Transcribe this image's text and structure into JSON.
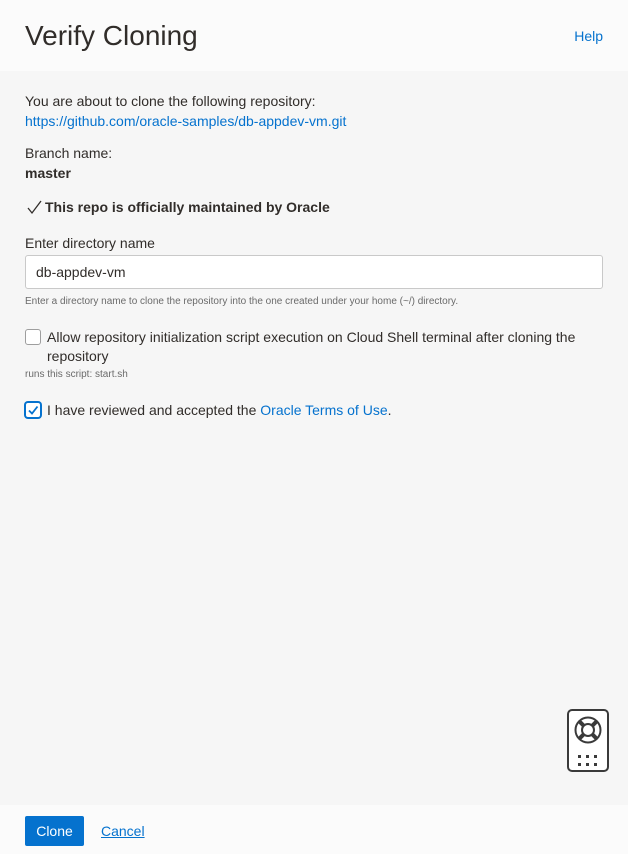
{
  "header": {
    "title": "Verify Cloning",
    "help_label": "Help"
  },
  "repo": {
    "intro": "You are about to clone the following repository:",
    "url": "https://github.com/oracle-samples/db-appdev-vm.git"
  },
  "branch": {
    "label": "Branch name:",
    "value": "master"
  },
  "maintained_text": "This repo is officially maintained by Oracle",
  "directory": {
    "label": "Enter directory name",
    "value": "db-appdev-vm",
    "help": "Enter a directory name to clone the repository into the one created under your home (~/) directory."
  },
  "init_script": {
    "checked": false,
    "label": "Allow repository initialization script execution on Cloud Shell terminal after cloning the repository",
    "note": "runs this script: start.sh"
  },
  "terms": {
    "checked": true,
    "prefix": "I have reviewed and accepted the ",
    "link": "Oracle Terms of Use",
    "suffix": "."
  },
  "footer": {
    "clone_label": "Clone",
    "cancel_label": "Cancel"
  },
  "colors": {
    "accent": "#0572ce",
    "text": "#312d2a",
    "background": "#f6f6f6"
  },
  "icons": {
    "maintained": "check-icon",
    "widget_top": "lifebuoy-icon",
    "widget_bottom": "grid-icon"
  }
}
